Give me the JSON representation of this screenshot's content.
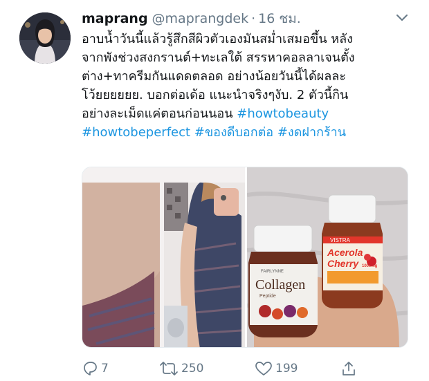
{
  "tweet": {
    "display_name": "maprang",
    "handle": "@maprangdek",
    "separator": "·",
    "time": "16 ชม.",
    "lines": [
      "อาบน้ำวันนี้แล้วรู้สึกสีผิวตัวเองมันสม่ำเสมอขึ้น หลัง",
      "จากพังช่วงสงกรานต์+ทะเลใต้  สรรหาคอลลาเจนตั้ง",
      "ต่าง+ทาครีมกันแดดตลอด อย่างน้อยวันนี้ได้ผลละ",
      "โว้ยยยยยย. บอกต่อเด้อ แนะนำจริงๆงับ. 2 ตัวนี้กิน"
    ],
    "line5_text": "อย่างละเม็ดแค่ตอนก่อนนอน ",
    "line5_hashtag": "#howtobeauty",
    "hashtags_line6": [
      "#howtobeperfect",
      "#ของดีบอกต่อ",
      "#งดฝากร้าน"
    ]
  },
  "media": {
    "left_photo": {
      "subject": "before-after skin comparison photo"
    },
    "right_photo": {
      "bottle_left": {
        "brand": "FAIRLYNNE",
        "product": "Collagen",
        "sub": "Peptide"
      },
      "bottle_right": {
        "brand": "VISTRA",
        "product": "Acerola",
        "product2": "Cherry",
        "dose": "1000mg"
      }
    }
  },
  "actions": {
    "reply_count": "7",
    "retweet_count": "250",
    "like_count": "199",
    "icons": [
      "reply-icon",
      "retweet-icon",
      "heart-icon",
      "share-icon"
    ]
  },
  "colors": {
    "text": "#14171a",
    "secondary": "#657786",
    "hashtag": "#1b95e0",
    "border": "#e6ecf0"
  }
}
